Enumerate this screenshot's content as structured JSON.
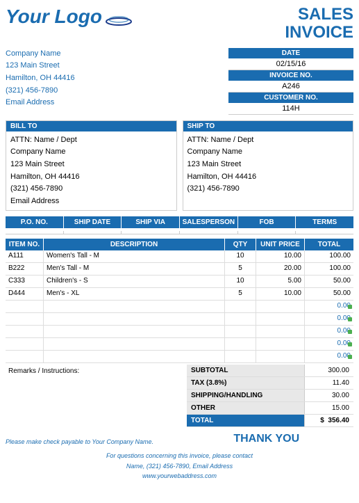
{
  "header": {
    "logo_text": "Your Logo",
    "title_line1": "SALES",
    "title_line2": "INVOICE"
  },
  "sender": {
    "company": "Company Name",
    "street": "123 Main Street",
    "city": "Hamilton, OH  44416",
    "phone": "(321) 456-7890",
    "email": "Email Address"
  },
  "invoice_meta": {
    "date_label": "DATE",
    "date_value": "02/15/16",
    "invoice_no_label": "INVOICE NO.",
    "invoice_no_value": "A246",
    "customer_no_label": "CUSTOMER NO.",
    "customer_no_value": "114H"
  },
  "bill_to": {
    "header": "BILL TO",
    "attn": "ATTN: Name / Dept",
    "company": "Company Name",
    "street": "123 Main Street",
    "city": "Hamilton, OH  44416",
    "phone": "(321) 456-7890",
    "email": "Email Address"
  },
  "ship_to": {
    "header": "SHIP TO",
    "attn": "ATTN: Name / Dept",
    "company": "Company Name",
    "street": "123 Main Street",
    "city": "Hamilton, OH  44416",
    "phone": "(321) 456-7890"
  },
  "po_headers": [
    "P.O. NO.",
    "SHIP DATE",
    "SHIP VIA",
    "SALESPERSON",
    "FOB",
    "TERMS"
  ],
  "items_headers": {
    "no": "ITEM NO.",
    "desc": "DESCRIPTION",
    "qty": "QTY",
    "price": "UNIT PRICE",
    "total": "TOTAL"
  },
  "items": [
    {
      "no": "A111",
      "desc": "Women's Tall - M",
      "qty": "10",
      "price": "10.00",
      "total": "100.00",
      "has_dot": false
    },
    {
      "no": "B222",
      "desc": "Men's Tall - M",
      "qty": "5",
      "price": "20.00",
      "total": "100.00",
      "has_dot": false
    },
    {
      "no": "C333",
      "desc": "Children's - S",
      "qty": "10",
      "price": "5.00",
      "total": "50.00",
      "has_dot": false
    },
    {
      "no": "D444",
      "desc": "Men's - XL",
      "qty": "5",
      "price": "10.00",
      "total": "50.00",
      "has_dot": false
    },
    {
      "no": "",
      "desc": "",
      "qty": "",
      "price": "",
      "total": "0.00",
      "has_dot": true
    },
    {
      "no": "",
      "desc": "",
      "qty": "",
      "price": "",
      "total": "0.00",
      "has_dot": true
    },
    {
      "no": "",
      "desc": "",
      "qty": "",
      "price": "",
      "total": "0.00",
      "has_dot": true
    },
    {
      "no": "",
      "desc": "",
      "qty": "",
      "price": "",
      "total": "0.00",
      "has_dot": true
    },
    {
      "no": "",
      "desc": "",
      "qty": "",
      "price": "",
      "total": "0.00",
      "has_dot": true
    }
  ],
  "totals": {
    "subtotal_label": "SUBTOTAL",
    "subtotal_value": "300.00",
    "tax_label": "TAX (3.8%)",
    "tax_value": "11.40",
    "shipping_label": "SHIPPING/HANDLING",
    "shipping_value": "30.00",
    "other_label": "OTHER",
    "other_value": "15.00",
    "total_label": "TOTAL",
    "total_dollar": "$",
    "total_value": "356.40"
  },
  "remarks_label": "Remarks / Instructions:",
  "check_payable": "Please make check payable to Your Company Name.",
  "thank_you": "THANK YOU",
  "contact_line1": "For questions concerning this invoice, please contact",
  "contact_line2": "Name, (321) 456-7890, Email Address",
  "website": "www.yourwebaddress.com"
}
